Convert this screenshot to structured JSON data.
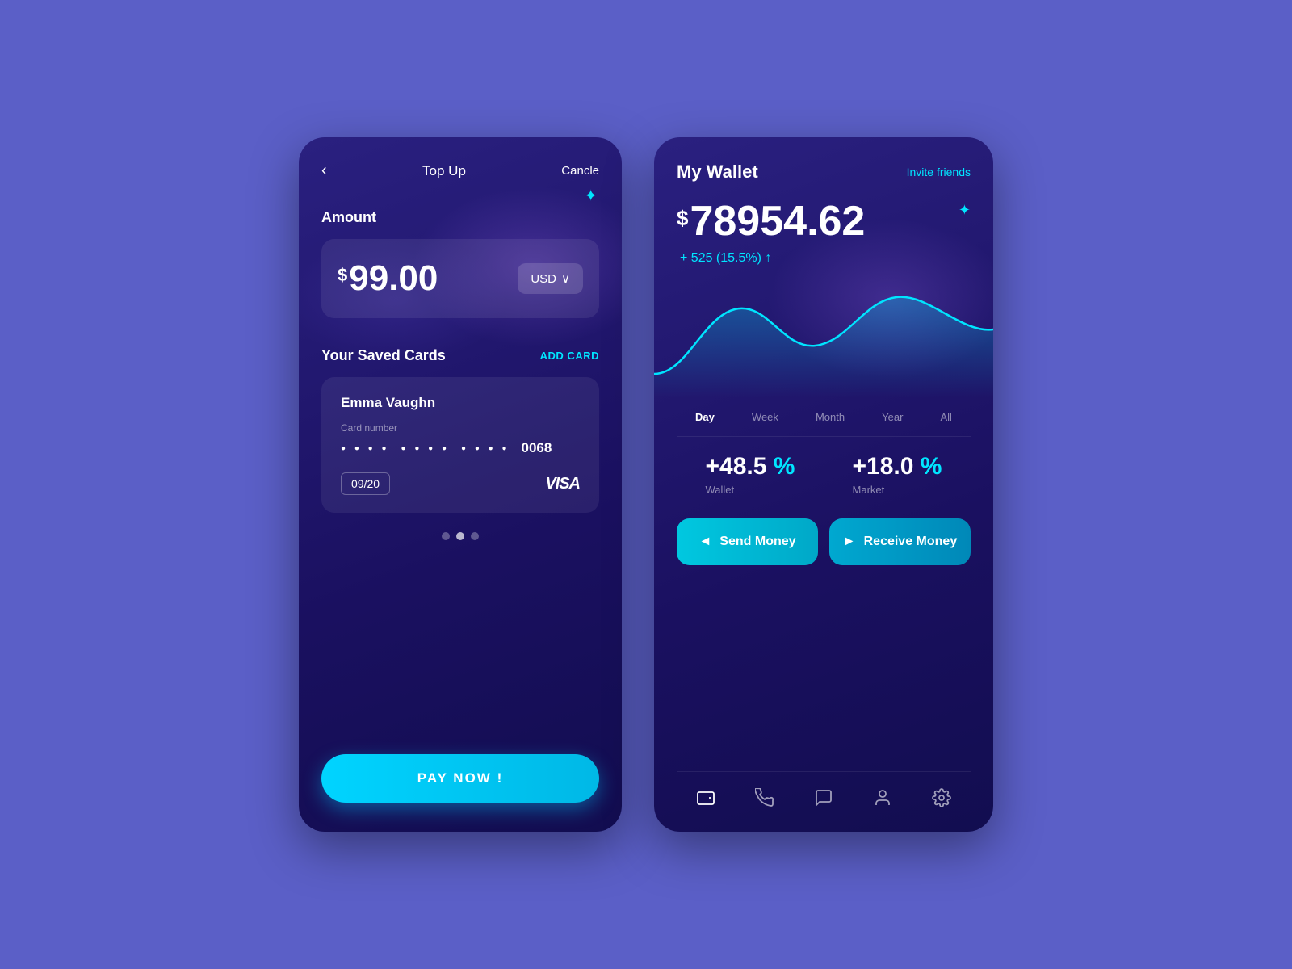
{
  "left": {
    "nav": {
      "back": "‹",
      "title": "Top Up",
      "cancel": "Cancle"
    },
    "amount_label": "Amount",
    "amount_value": "99.00",
    "currency": "USD",
    "saved_cards_label": "Your Saved Cards",
    "add_card": "ADD CARD",
    "card": {
      "name": "Emma Vaughn",
      "number_label": "Card number",
      "dots1": "● ● ● ●",
      "dots2": "● ● ● ●",
      "dots3": "● ● ● ●",
      "last4": "0068",
      "expiry": "09/20",
      "brand": "VISA"
    },
    "pay_btn": "PAY NOW !"
  },
  "right": {
    "title": "My Wallet",
    "invite": "Invite friends",
    "balance": "78954.62",
    "change": "+ 525 (15.5%) ↑",
    "time_tabs": [
      "Day",
      "Week",
      "Month",
      "Year",
      "All"
    ],
    "active_tab": "Day",
    "wallet_stat": "+48.5",
    "wallet_label": "Wallet",
    "market_stat": "+18.0",
    "market_label": "Market",
    "percent": "%",
    "send_btn": "Send Money",
    "receive_btn": "Receive Money",
    "nav_icons": [
      "wallet-icon",
      "phone-icon",
      "chat-icon",
      "user-icon",
      "settings-icon"
    ]
  }
}
